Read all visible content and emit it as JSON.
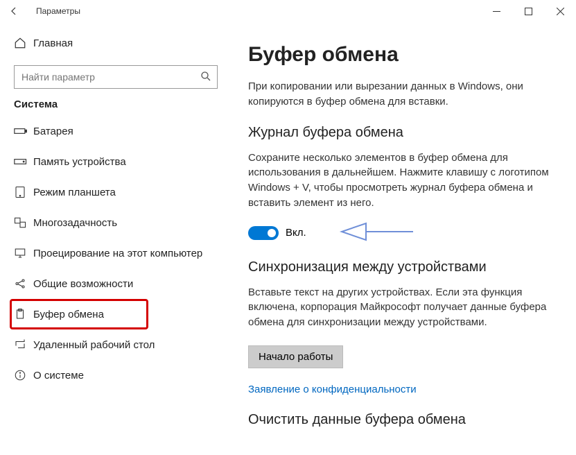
{
  "window": {
    "title": "Параметры"
  },
  "sidebar": {
    "home": "Главная",
    "search_placeholder": "Найти параметр",
    "group": "Система",
    "items": [
      {
        "label": "Батарея"
      },
      {
        "label": "Память устройства"
      },
      {
        "label": "Режим планшета"
      },
      {
        "label": "Многозадачность"
      },
      {
        "label": "Проецирование на этот компьютер"
      },
      {
        "label": "Общие возможности"
      },
      {
        "label": "Буфер обмена"
      },
      {
        "label": "Удаленный рабочий стол"
      },
      {
        "label": "О системе"
      }
    ]
  },
  "main": {
    "title": "Буфер обмена",
    "intro": "При копировании или вырезании данных в Windows, они копируются в буфер обмена для вставки.",
    "history": {
      "heading": "Журнал буфера обмена",
      "desc": "Сохраните несколько элементов в буфер обмена для использования в дальнейшем. Нажмите клавишу с логотипом Windows + V, чтобы просмотреть журнал буфера обмена и вставить элемент из него.",
      "toggle_label": "Вкл."
    },
    "sync": {
      "heading": "Синхронизация между устройствами",
      "desc": "Вставьте текст на других устройствах. Если эта функция включена, корпорация Майкрософт получает данные буфера обмена для синхронизации между устройствами.",
      "button": "Начало работы"
    },
    "privacy_link": "Заявление о конфиденциальности",
    "clear": {
      "heading": "Очистить данные буфера обмена"
    }
  }
}
